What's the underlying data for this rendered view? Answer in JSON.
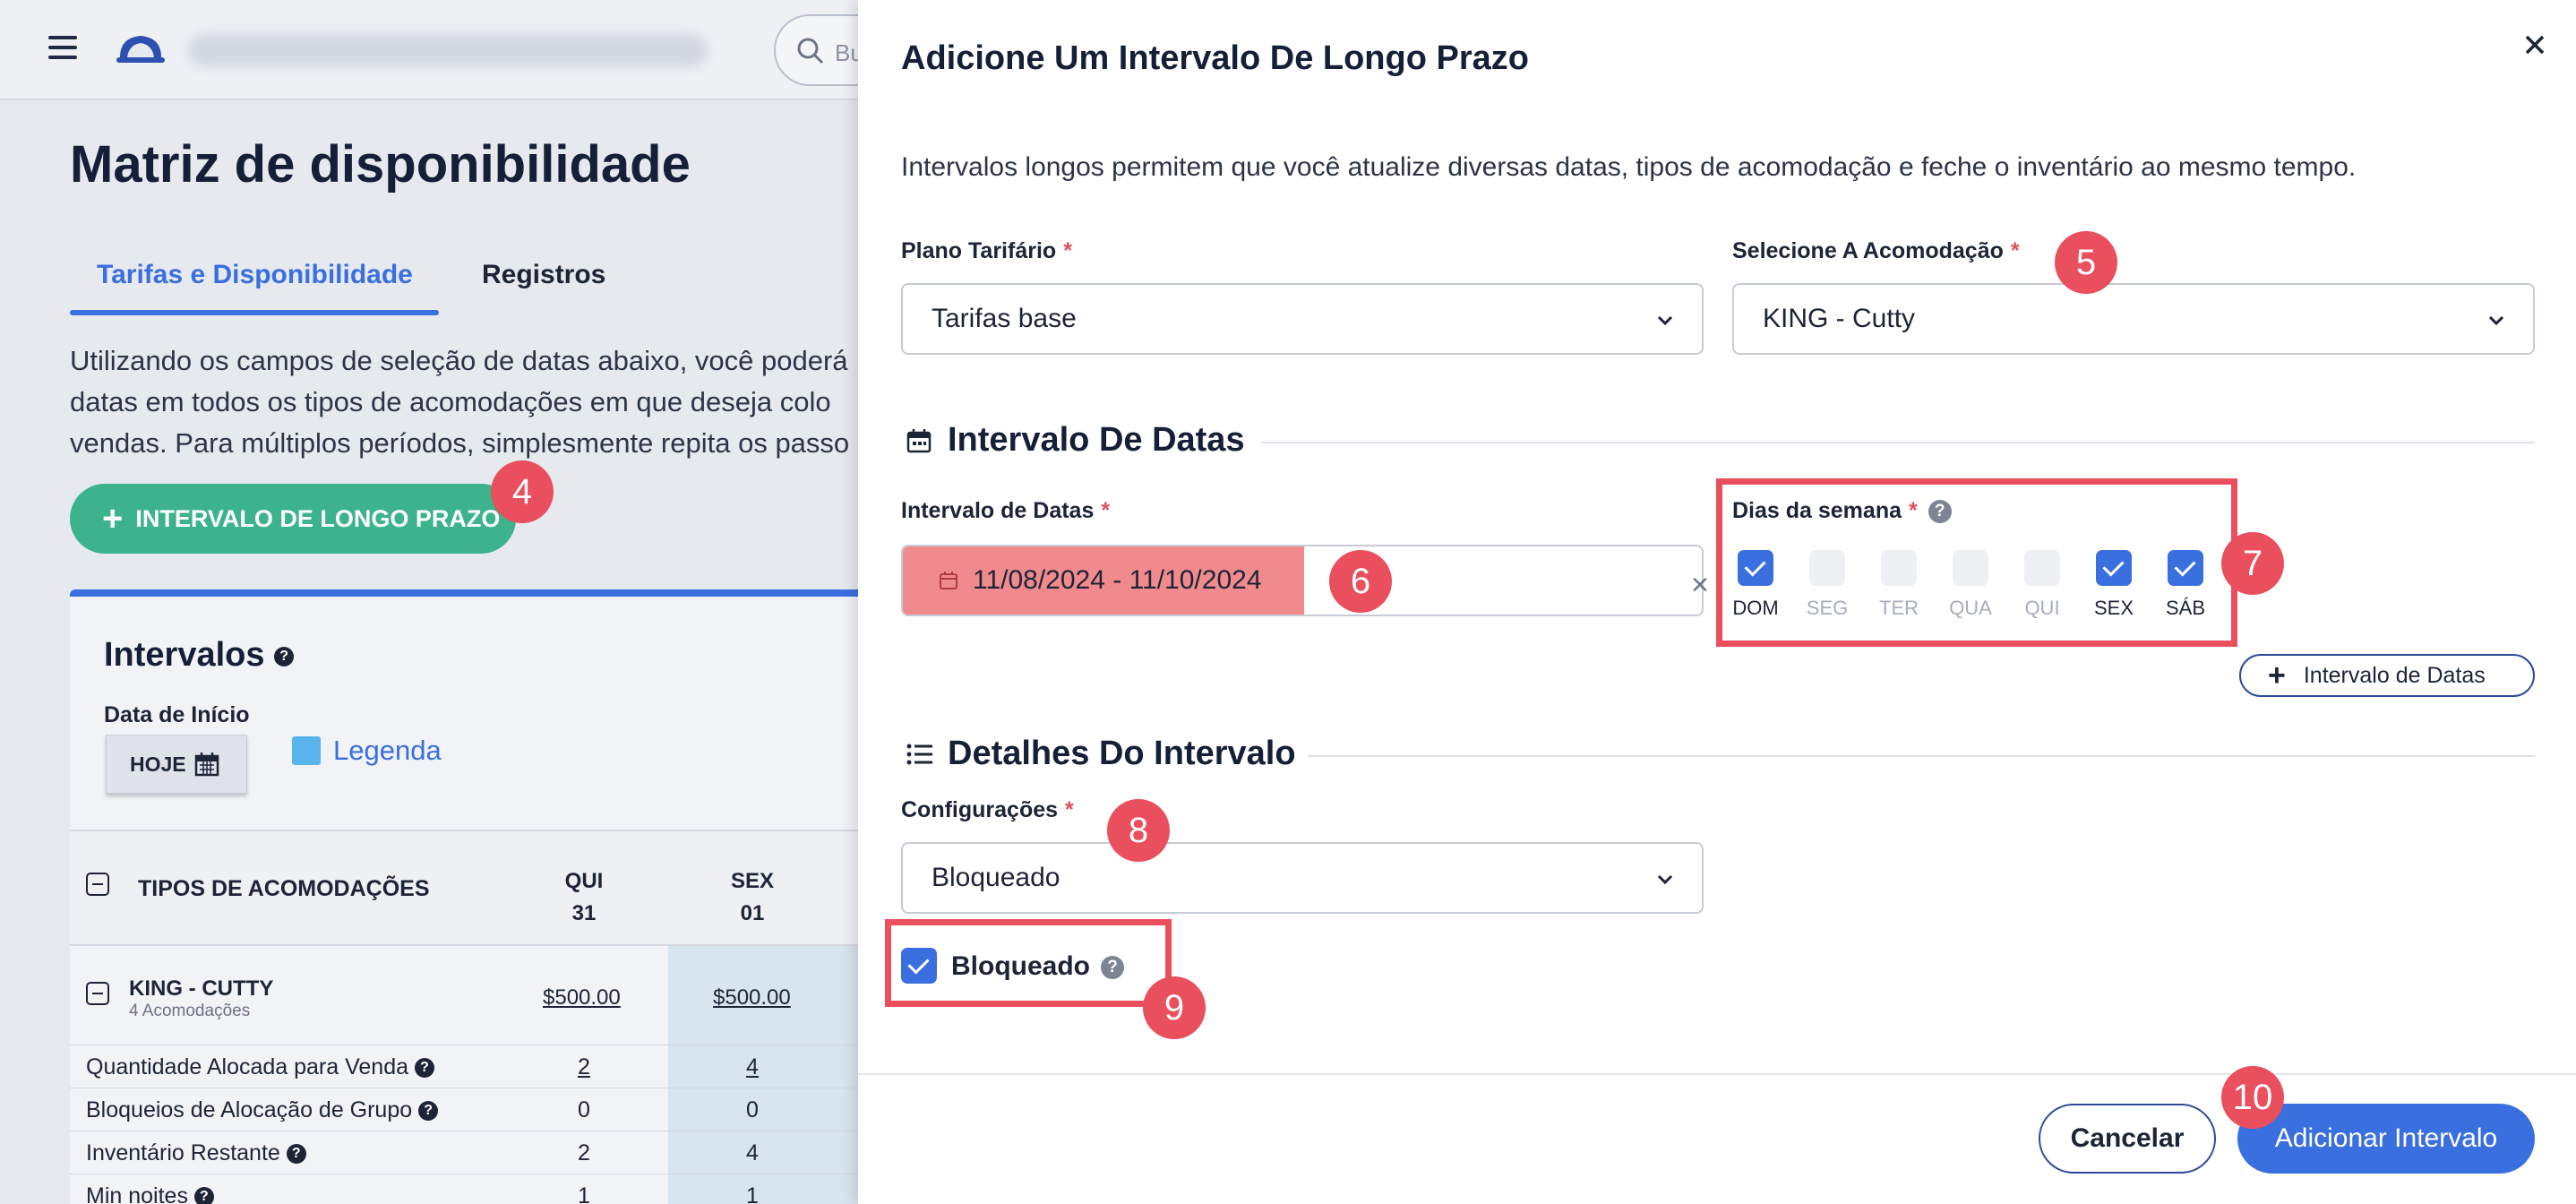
{
  "background": {
    "search_placeholder": "Bu",
    "page_title": "Matriz de disponibilidade",
    "tabs": [
      {
        "label": "Tarifas e Disponibilidade",
        "active": true
      },
      {
        "label": "Registros",
        "active": false
      }
    ],
    "intro_lines": [
      "Utilizando os campos de seleção de datas abaixo, você poderá",
      "datas em todos os tipos de acomodações em que deseja colo",
      "vendas. Para múltiplos períodos, simplesmente repita os passo"
    ],
    "long_range_button": "INTERVALO DE LONGO PRAZO",
    "card": {
      "title": "Intervalos",
      "start_date_label": "Data de Início",
      "today_button": "HOJE",
      "legend_label": "Legenda",
      "table_header": "TIPOS DE ACOMODAÇÕES",
      "columns": [
        {
          "day": "QUI",
          "date": "31"
        },
        {
          "day": "SEX",
          "date": "01"
        }
      ],
      "room": {
        "name": "KING - CUTTY",
        "sub": "4 Acomodações",
        "prices": [
          "$500.00",
          "$500.00"
        ]
      },
      "rows": [
        {
          "label": "Quantidade Alocada para Venda",
          "values": [
            "2",
            "4"
          ]
        },
        {
          "label": "Bloqueios de Alocação de Grupo",
          "values": [
            "0",
            "0"
          ]
        },
        {
          "label": "Inventário Restante",
          "values": [
            "2",
            "4"
          ]
        },
        {
          "label": "Min noites",
          "values": [
            "1",
            "1"
          ]
        }
      ]
    }
  },
  "drawer": {
    "title": "Adicione Um Intervalo De Longo Prazo",
    "description": "Intervalos longos permitem que você atualize diversas datas, tipos de acomodação e feche o inventário ao mesmo tempo.",
    "rate_plan": {
      "label": "Plano Tarifário",
      "value": "Tarifas base"
    },
    "room_select": {
      "label": "Selecione A Acomodação",
      "value": "KING - Cutty"
    },
    "date_section_title": "Intervalo De Datas",
    "date_range": {
      "label": "Intervalo de Datas",
      "value": "11/08/2024 - 11/10/2024"
    },
    "weekdays": {
      "label": "Dias da semana",
      "days": [
        {
          "label": "DOM",
          "checked": true
        },
        {
          "label": "SEG",
          "checked": false
        },
        {
          "label": "TER",
          "checked": false
        },
        {
          "label": "QUA",
          "checked": false
        },
        {
          "label": "QUI",
          "checked": false
        },
        {
          "label": "SEX",
          "checked": true
        },
        {
          "label": "SÁB",
          "checked": true
        }
      ]
    },
    "add_date_range_button": "Intervalo de Datas",
    "details_section_title": "Detalhes Do Intervalo",
    "settings": {
      "label": "Configurações",
      "value": "Bloqueado"
    },
    "blocked_checkbox": {
      "label": "Bloqueado",
      "checked": true
    },
    "cancel_button": "Cancelar",
    "add_button": "Adicionar Intervalo"
  },
  "step_badges": [
    "4",
    "5",
    "6",
    "7",
    "8",
    "9",
    "10"
  ],
  "colors": {
    "accent": "#3a6fe0",
    "green": "#3cb38d",
    "highlight_red": "#e94f5c",
    "date_highlight": "#f08a8d"
  }
}
